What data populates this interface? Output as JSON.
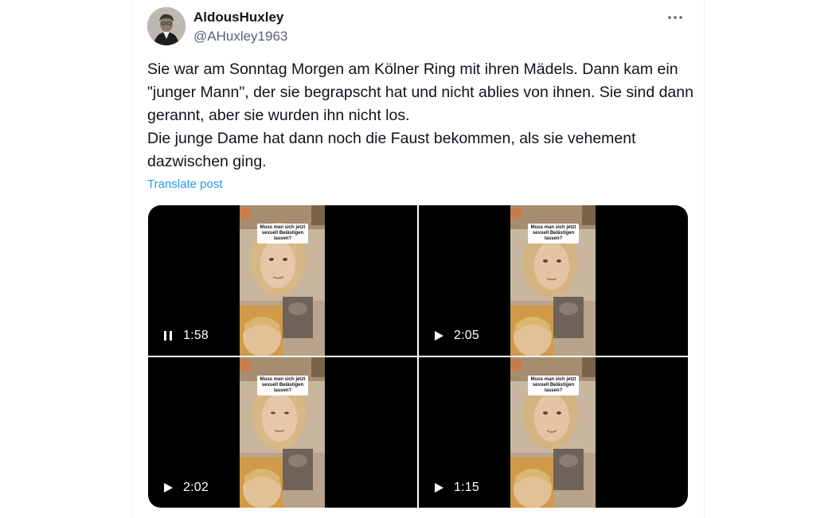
{
  "author": {
    "display_name": "AldousHuxley",
    "handle": "@AHuxley1963",
    "avatar_icon": "avatar-photo"
  },
  "tweet": {
    "paragraphs": [
      "Sie war am Sonntag Morgen am Kölner Ring mit ihren Mädels. Dann kam ein \"junger Mann\", der sie begrapscht hat und nicht ablies von ihnen. Sie sind dann gerannt, aber sie wurden ihn nicht los.",
      "Die junge Dame hat dann noch die Faust bekommen, als sie vehement dazwischen ging."
    ],
    "translate_label": "Translate post"
  },
  "media": {
    "videos": [
      {
        "state": "playing",
        "icon": "pause-icon",
        "duration": "1:58",
        "caption": "Muss man sich jetzt sexuell Belästigen lassen?"
      },
      {
        "state": "paused",
        "icon": "play-icon",
        "duration": "2:05",
        "caption": "Muss man sich jetzt sexuell Belästigen lassen?"
      },
      {
        "state": "paused",
        "icon": "play-icon",
        "duration": "2:02",
        "caption": "Muss man sich jetzt sexuell Belästigen lassen?"
      },
      {
        "state": "paused",
        "icon": "play-icon",
        "duration": "1:15",
        "caption": "Muss man sich jetzt sexuell Belästigen lassen?"
      }
    ]
  },
  "colors": {
    "text": "#0f1419",
    "secondary": "#536471",
    "link": "#1d9bf0",
    "video_bg": "#000000"
  }
}
